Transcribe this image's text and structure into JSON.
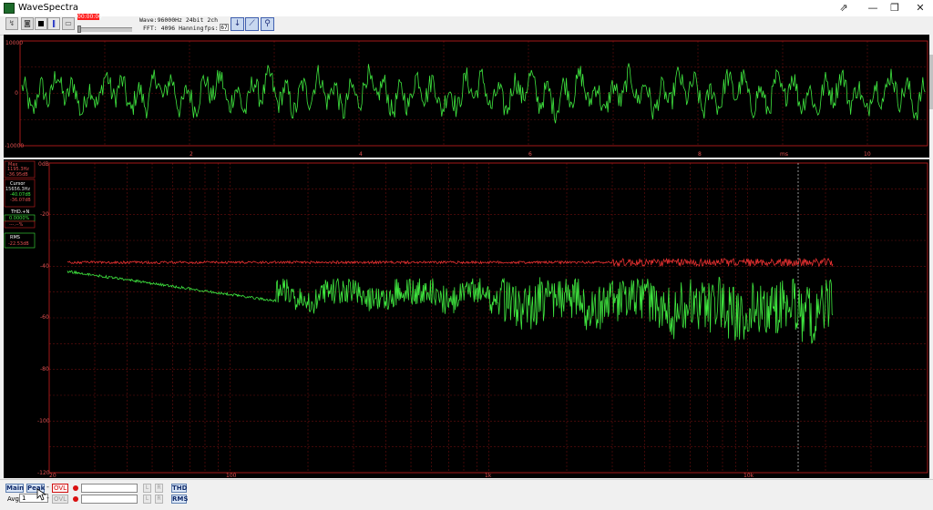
{
  "window": {
    "title": "WaveSpectra",
    "controls": {
      "restore": "⇗",
      "minimize": "—",
      "maximize": "❐",
      "close": "✕"
    }
  },
  "toolbar": {
    "record_time": "00:00:00",
    "wave_info": "Wave:96000Hz 24bit 2ch",
    "fft_info": "FFT: 4096 Hanning",
    "fps_label": "fps:",
    "fps_value": "67"
  },
  "wave_plot": {
    "y_labels": [
      "10000",
      "0",
      "-10000"
    ],
    "x_labels": [
      "2",
      "4",
      "6",
      "8",
      "ms",
      "10"
    ],
    "colors": {
      "trace": "#3fe63f",
      "grid": "#6a0f0f",
      "frame": "#cc2020",
      "text": "#e05050"
    }
  },
  "spectrum_plot": {
    "y_labels": [
      "0dB",
      "-20",
      "-40",
      "-60",
      "-80",
      "-100",
      "-120"
    ],
    "x_labels": [
      "20",
      "100",
      "1k",
      "10k"
    ],
    "colors": {
      "peak": "#e83030",
      "current": "#3fe63f",
      "grid": "#6a0f0f",
      "frame": "#cc2020",
      "text": "#e05050",
      "cursor": "#d0d0d0"
    }
  },
  "readouts": {
    "max": {
      "label": "Max",
      "freq": "1195.3Hz",
      "db": "-36.95dB"
    },
    "cursor": {
      "label": "Cursor",
      "freq": "15656.3Hz",
      "db1": "-40.07dB",
      "db2": "-36.07dB"
    },
    "thd": {
      "label": "THD.+N",
      "value": "0.0000%",
      "value2": "---.--%"
    },
    "rms": {
      "label": "RMS",
      "value": "-22.53dB"
    }
  },
  "bottom": {
    "main_label": "Main",
    "peak_label": "Peak",
    "ovl_label": "OVL",
    "dash": "-",
    "l_label": "L",
    "r_label": "R",
    "thd_label": "THD",
    "rms_label": "RMS",
    "avg_label": "Avg:",
    "avg_value": "1"
  }
}
